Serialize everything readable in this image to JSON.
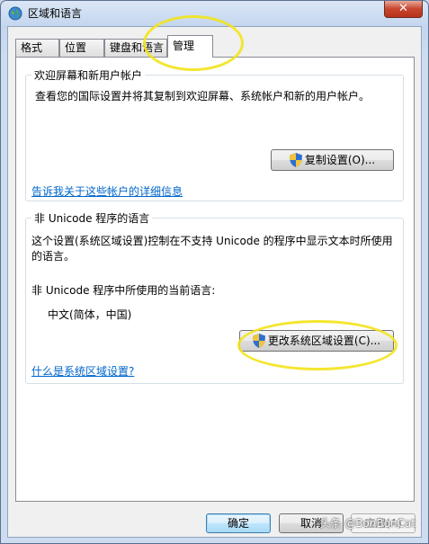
{
  "window": {
    "title": "区域和语言",
    "close_glyph": "✕"
  },
  "tabs": [
    {
      "label": "格式",
      "active": false
    },
    {
      "label": "位置",
      "active": false
    },
    {
      "label": "键盘和语言",
      "active": false
    },
    {
      "label": "管理",
      "active": true
    }
  ],
  "welcome_group": {
    "title": "欢迎屏幕和新用户帐户",
    "description": "查看您的国际设置并将其复制到欢迎屏幕、系统帐户和新的用户帐户。",
    "copy_button": "复制设置(O)...",
    "info_link": "告诉我关于这些帐户的详细信息"
  },
  "unicode_group": {
    "title": "非 Unicode 程序的语言",
    "description": "这个设置(系统区域设置)控制在不支持 Unicode 的程序中显示文本时所使用的语言。",
    "current_label": "非 Unicode 程序中所使用的当前语言:",
    "current_value": "中文(简体，中国)",
    "change_button": "更改系统区域设置(C)...",
    "help_link": "什么是系统区域设置?"
  },
  "footer": {
    "ok": "确定",
    "cancel": "取消",
    "apply": "应用(A)"
  },
  "watermark": "头条 @BonBonCat",
  "colors": {
    "highlight": "#f3e31a",
    "link": "#0066cc",
    "close": "#c7452e"
  }
}
